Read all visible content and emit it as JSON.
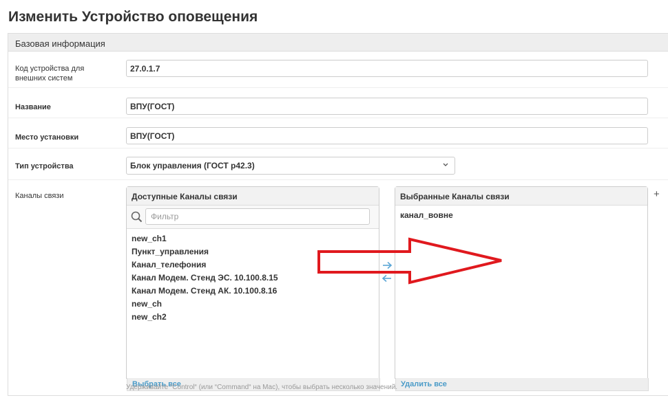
{
  "page": {
    "title": "Изменить Устройство оповещения"
  },
  "fieldset": {
    "title": "Базовая информация"
  },
  "fields": {
    "external_code": {
      "label": "Код устройства для внешних систем",
      "value": "27.0.1.7"
    },
    "name": {
      "label": "Название",
      "value": "ВПУ(ГОСТ)"
    },
    "location": {
      "label": "Место установки",
      "value": "ВПУ(ГОСТ)"
    },
    "device_type": {
      "label": "Тип устройства",
      "value": "Блок управления (ГОСТ р42.3)"
    },
    "channels": {
      "label": "Каналы связи"
    }
  },
  "channels_selector": {
    "available": {
      "title": "Доступные Каналы связи",
      "filter_placeholder": "Фильтр",
      "options": [
        "new_ch1",
        "Пункт_управления",
        "Канал_телефония",
        "Канал Модем. Стенд ЭС. 10.100.8.15",
        "Канал Модем. Стенд АК. 10.100.8.16",
        "new_ch",
        "new_ch2"
      ],
      "choose_all": "Выбрать все"
    },
    "chosen": {
      "title": "Выбранные Каналы связи",
      "options": [
        "канал_вовне"
      ],
      "remove_all": "Удалить все"
    },
    "add_label": "+",
    "help_text": "Удерживайте “Control“ (или “Command“ на Mac), чтобы выбрать несколько значений."
  },
  "colors": {
    "link": "#4a9bc8",
    "annotation_arrow": "#e0191e",
    "move_arrow": "#5aa6d6"
  }
}
